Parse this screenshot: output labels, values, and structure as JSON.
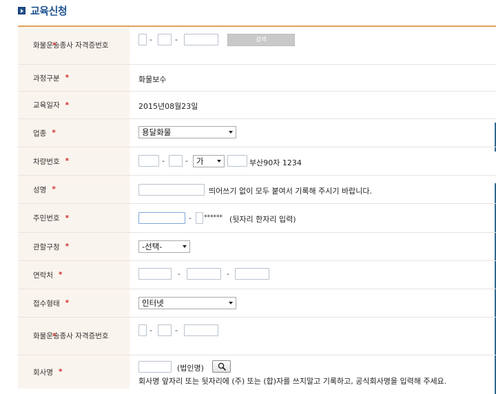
{
  "page": {
    "title": "교육신청"
  },
  "search_button_label": "검색",
  "required_mark": "*",
  "rows": {
    "license": {
      "label": "화물운송종사 자격증번호"
    },
    "course": {
      "label": "과정구분",
      "value": "화물보수"
    },
    "date": {
      "label": "교육일자",
      "value": "2015년08월23일"
    },
    "industry": {
      "label": "업종",
      "selected": "용달화물"
    },
    "vehicle": {
      "label": "차량번호",
      "selected": "가",
      "example": "부산90자 1234"
    },
    "name": {
      "label": "성명",
      "hint": "띄어쓰기 없이 모두 붙여서 기록해 주시기 바랍니다."
    },
    "rrn": {
      "label": "주민번호",
      "masked": "******",
      "hint": "(뒷자리 한자리 입력)"
    },
    "office": {
      "label": "관할구청",
      "selected": "-선택-"
    },
    "contact": {
      "label": "연락처"
    },
    "receipt": {
      "label": "접수형태",
      "selected": "인터넷"
    },
    "license2": {
      "label": "화물운송종사 자격증번호"
    },
    "company": {
      "label": "회사명",
      "corp_hint": "(법인명)",
      "note": "회사명 앞자리 또는 뒷자리에 (주) 또는 (합)자를 쓰지말고 기록하고, 공식회사명을 입력해 주세요."
    }
  },
  "icons": {
    "title": "arrow-right-icon",
    "search": "magnifier-icon"
  },
  "colors": {
    "accent": "#e2a15a",
    "title": "#1f5390",
    "required": "#d0302c",
    "label_bg": "#faf4ee"
  }
}
